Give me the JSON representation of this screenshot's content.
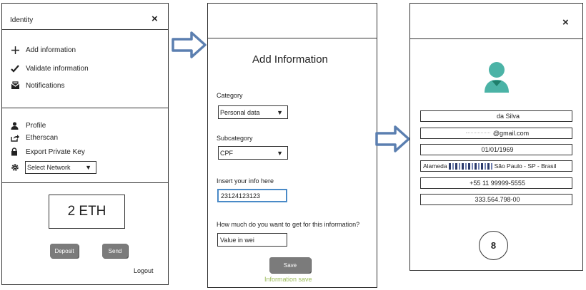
{
  "panel1": {
    "title": "Identity",
    "close_label": "×",
    "menu_top": [
      {
        "label": "Add information",
        "icon": "plus-icon"
      },
      {
        "label": "Validate information",
        "icon": "check-icon"
      },
      {
        "label": "Notifications",
        "icon": "envelope-icon"
      }
    ],
    "menu_bottom": [
      {
        "label": "Profile",
        "icon": "user-icon"
      },
      {
        "label": "Etherscan",
        "icon": "share-icon"
      },
      {
        "label": "Export Private Key",
        "icon": "lock-icon"
      }
    ],
    "network_select": {
      "value": "Select Network",
      "icon": "gear-icon"
    },
    "balance": "2 ETH",
    "deposit_label": "Deposit",
    "send_label": "Send",
    "logout_label": "Logout"
  },
  "panel2": {
    "close_label": "",
    "heading": "Add Information",
    "category_label": "Category",
    "category_value": "Personal data",
    "subcategory_label": "Subcategory",
    "subcategory_value": "CPF",
    "info_label": "Insert your info here",
    "info_value": "23124123123",
    "price_label": "How much do you want to get for this information?",
    "price_value": "Value in wei",
    "save_label": "Save",
    "status": "Information save"
  },
  "panel3": {
    "close_label": "×",
    "fields": [
      {
        "value": "da Silva"
      },
      {
        "value": "@gmail.com"
      },
      {
        "value": "01/01/1969"
      },
      {
        "value_prefix": "Alameda",
        "value_suffix": "São Paulo - SP - Brasil"
      },
      {
        "value": "+55 11 99999-5555"
      },
      {
        "value": "333.564.798-00"
      }
    ],
    "badge": "8"
  },
  "colors": {
    "arrow": "#5b7fb0",
    "avatar": "#4bb3a6",
    "avatar_dark": "#1f7f6c",
    "button_gray": "#7b7b7b",
    "status_green": "#9bbb59",
    "input_focus": "#4a8ac7"
  }
}
